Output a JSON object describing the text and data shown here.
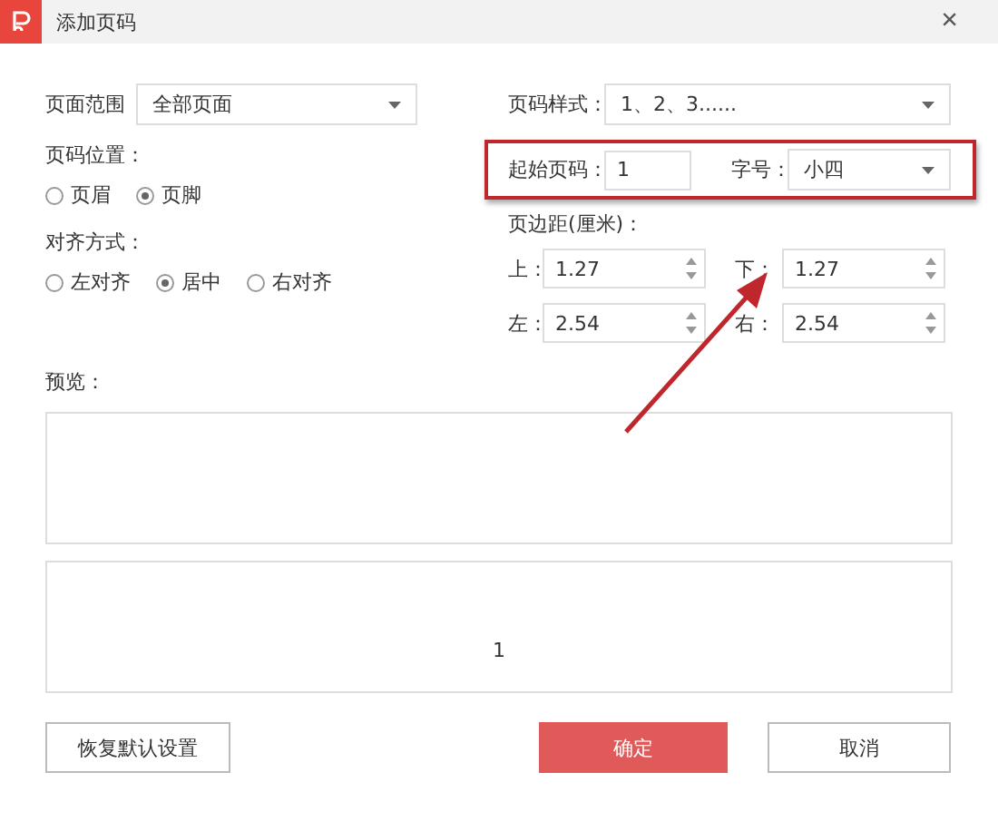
{
  "window": {
    "title": "添加页码",
    "close": "×"
  },
  "page_range": {
    "label": "页面范围",
    "value": "全部页面"
  },
  "number_style": {
    "label": "页码样式：",
    "value": "1、2、3......"
  },
  "position": {
    "label": "页码位置：",
    "options": [
      {
        "label": "页眉",
        "selected": false
      },
      {
        "label": "页脚",
        "selected": true
      }
    ]
  },
  "start_number": {
    "label": "起始页码：",
    "value": "1"
  },
  "font_size": {
    "label": "字号：",
    "value": "小四"
  },
  "alignment": {
    "label": "对齐方式：",
    "options": [
      {
        "label": "左对齐",
        "selected": false
      },
      {
        "label": "居中",
        "selected": true
      },
      {
        "label": "右对齐",
        "selected": false
      }
    ]
  },
  "margins": {
    "label": "页边距(厘米)：",
    "fields": [
      {
        "label": "上：",
        "value": "1.27"
      },
      {
        "label": "下：",
        "value": "1.27"
      },
      {
        "label": "左：",
        "value": "2.54"
      },
      {
        "label": "右：",
        "value": "2.54"
      }
    ]
  },
  "preview": {
    "label": "预览：",
    "page_number": "1"
  },
  "buttons": [
    {
      "label": "恢复默认设置",
      "kind": "default"
    },
    {
      "label": "确定",
      "kind": "primary"
    },
    {
      "label": "取消",
      "kind": "default"
    }
  ]
}
